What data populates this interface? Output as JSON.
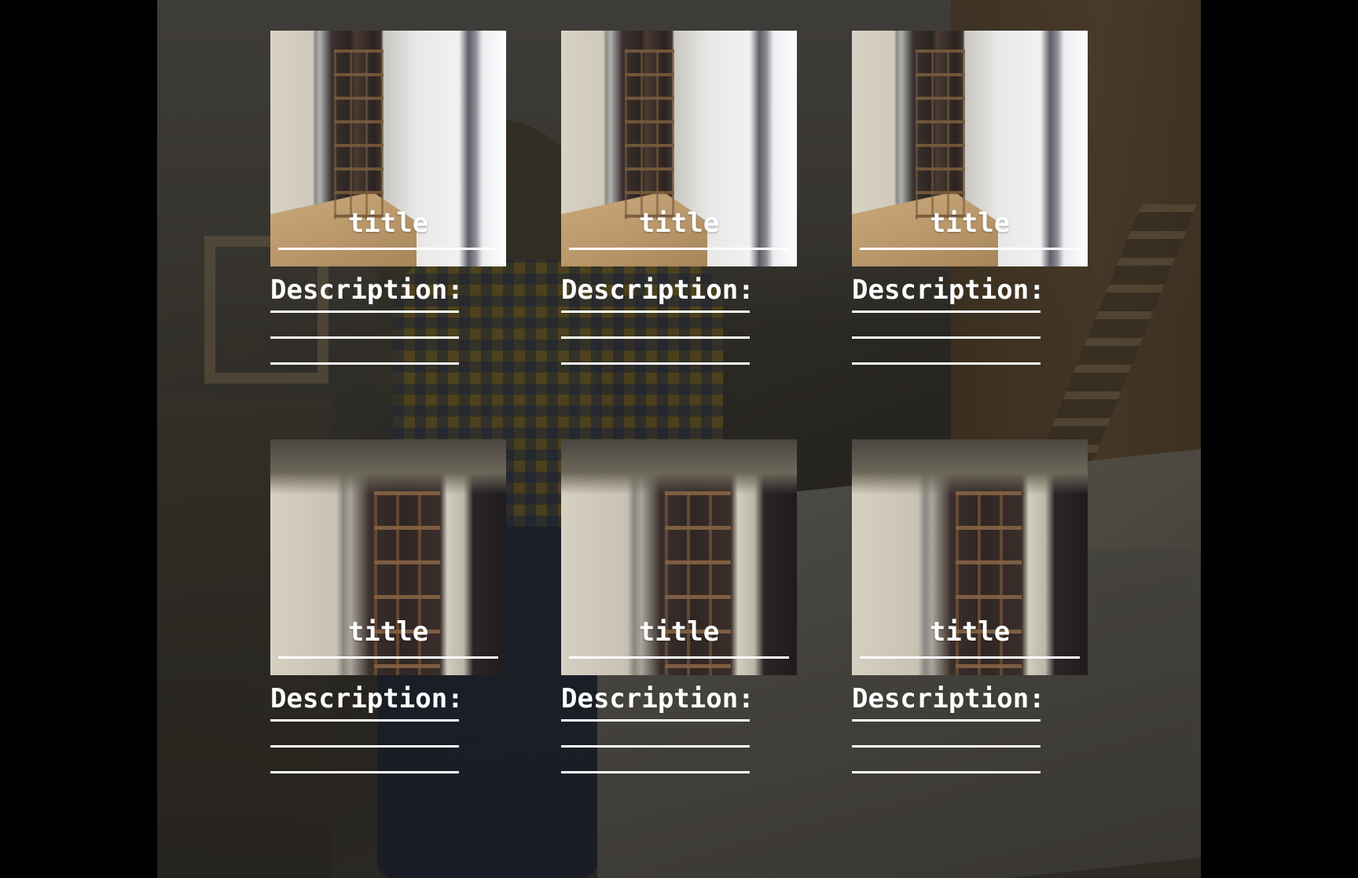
{
  "gallery": {
    "cards": [
      {
        "title": "title",
        "description_label": "Description:",
        "image": "wardrobe-closet-photo"
      },
      {
        "title": "title",
        "description_label": "Description:",
        "image": "wardrobe-closet-photo"
      },
      {
        "title": "title",
        "description_label": "Description:",
        "image": "wardrobe-closet-photo"
      },
      {
        "title": "title",
        "description_label": "Description:",
        "image": "wardrobe-shelves-photo"
      },
      {
        "title": "title",
        "description_label": "Description:",
        "image": "wardrobe-shelves-photo"
      },
      {
        "title": "title",
        "description_label": "Description:",
        "image": "wardrobe-shelves-photo"
      }
    ]
  },
  "background": {
    "image": "carpenter-workshop-photo"
  },
  "colors": {
    "text": "#ffffff",
    "letterbox": "#000000"
  }
}
